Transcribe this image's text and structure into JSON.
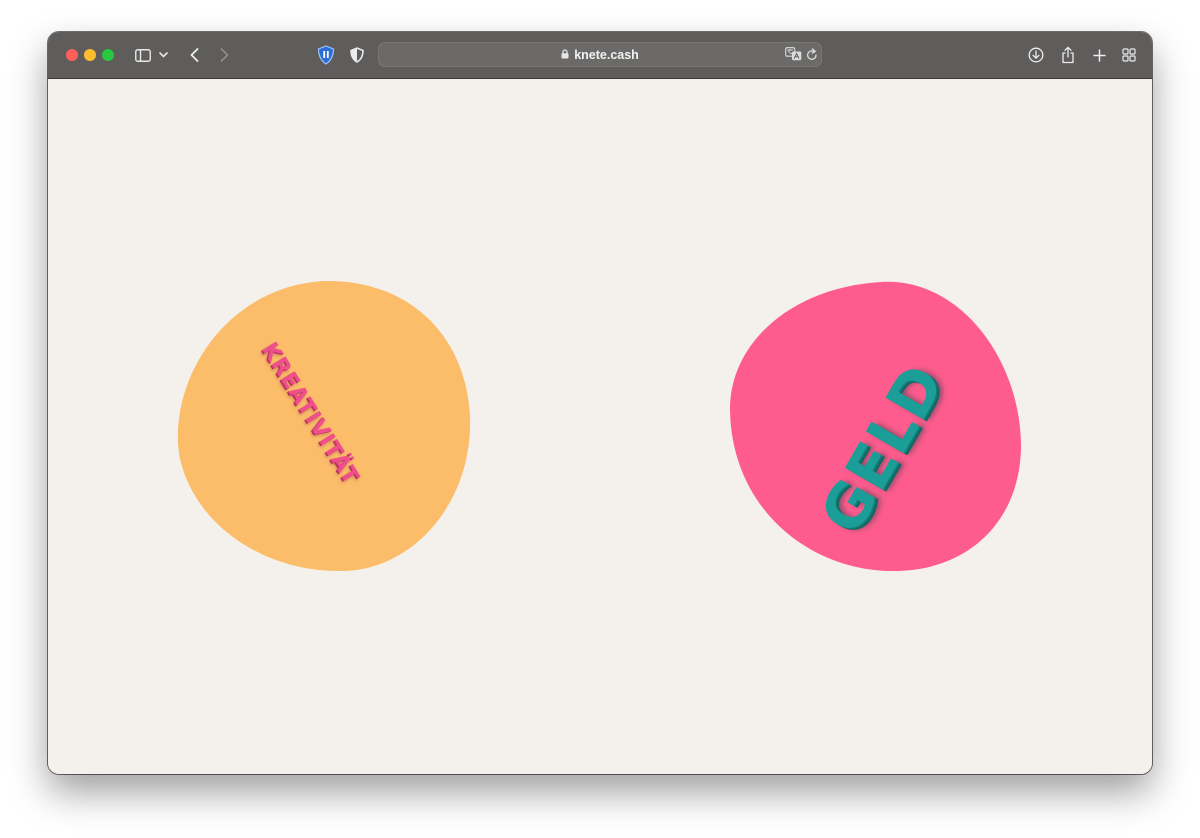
{
  "browser": {
    "url": "knete.cash",
    "colors": {
      "toolbar": "#5e5d5c",
      "close": "#fe5f57",
      "minimize": "#febc2e",
      "maximize": "#28c840"
    }
  },
  "page": {
    "background": "#f4f1ec",
    "left_blob": {
      "color": "#fcbd6a",
      "word": "KREATIVITÄT",
      "word_color": "#f0508a"
    },
    "right_blob": {
      "color": "#fe5c8e",
      "word": "GELD",
      "word_color": "#1c9e98"
    }
  }
}
